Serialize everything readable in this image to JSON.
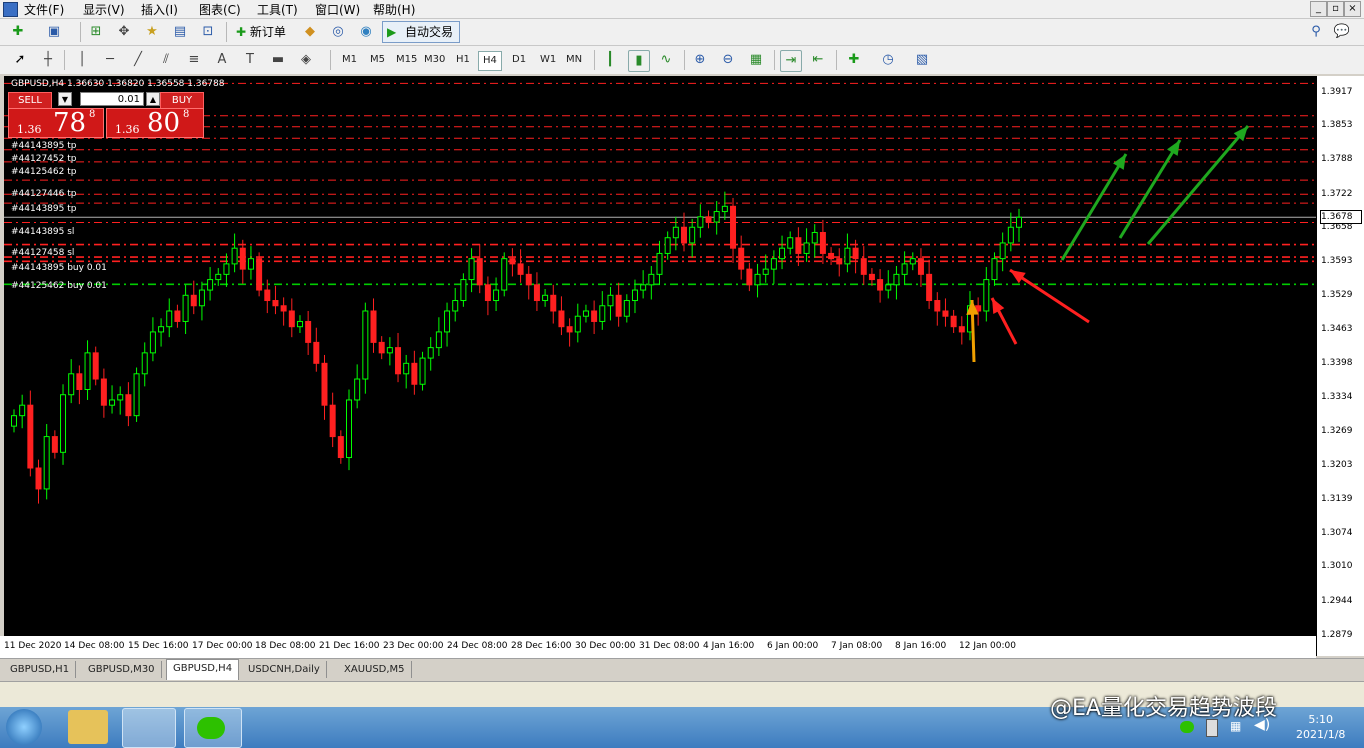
{
  "menu": {
    "items": [
      "文件(F)",
      "显示(V)",
      "插入(I)",
      "图表(C)",
      "工具(T)",
      "窗口(W)",
      "帮助(H)"
    ]
  },
  "toolbar": {
    "new_order_label": "新订单",
    "autotrade_label": "自动交易",
    "timeframes": [
      "M1",
      "M5",
      "M15",
      "M30",
      "H1",
      "H4",
      "D1",
      "W1",
      "MN"
    ],
    "active_timeframe": "H4"
  },
  "chart": {
    "header": "GBPUSD,H4  1.36630 1.36820 1.36558 1.36788",
    "current_price": "1.3678",
    "colors": {
      "bull": "#00ff00",
      "bear": "#ff2020",
      "background": "#000000",
      "tp_sl_line": "#ff2020",
      "buy_line": "#00cc00"
    },
    "order_labels": [
      "#44143895 tp",
      "#44127452 tp",
      "#44125462 tp",
      "#44127446 tp",
      "#44143895 tp",
      "#44143895 sl",
      "#44127458 sl",
      "#44143895 buy 0.01",
      "#44125462 buy 0.01"
    ]
  },
  "trade_panel": {
    "sell_label": "SELL",
    "buy_label": "BUY",
    "lot": "0.01",
    "sell_small": "1.36",
    "sell_big": "78",
    "sell_sup": "8",
    "buy_small": "1.36",
    "buy_big": "80",
    "buy_sup": "8"
  },
  "chart_data": {
    "type": "candlestick",
    "symbol": "GBPUSD",
    "timeframe": "H4",
    "ylim": [
      1.2879,
      1.3949
    ],
    "y_ticks": [
      "1.3917",
      "1.3853",
      "1.3788",
      "1.3722",
      "1.3658",
      "1.3593",
      "1.3529",
      "1.3463",
      "1.3398",
      "1.3334",
      "1.3269",
      "1.3203",
      "1.3139",
      "1.3074",
      "1.3010",
      "1.2944",
      "1.2879"
    ],
    "x_ticks": [
      "11 Dec 2020",
      "14 Dec 08:00",
      "15 Dec 16:00",
      "17 Dec 00:00",
      "18 Dec 08:00",
      "21 Dec 16:00",
      "23 Dec 00:00",
      "24 Dec 08:00",
      "28 Dec 16:00",
      "30 Dec 00:00",
      "31 Dec 08:00",
      "4 Jan 16:00",
      "6 Jan 00:00",
      "7 Jan 08:00",
      "8 Jan 16:00",
      "12 Jan 00:00"
    ],
    "red_levels": [
      1.3935,
      1.3873,
      1.3852,
      1.383,
      1.3808,
      1.3785,
      1.375,
      1.3723,
      1.3706,
      1.3669,
      1.3627,
      1.3603,
      1.3595
    ],
    "green_levels": [
      1.3551
    ],
    "closes": [
      1.33,
      1.332,
      1.32,
      1.316,
      1.326,
      1.323,
      1.334,
      1.338,
      1.335,
      1.342,
      1.337,
      1.332,
      1.333,
      1.334,
      1.33,
      1.338,
      1.342,
      1.346,
      1.347,
      1.35,
      1.348,
      1.353,
      1.351,
      1.354,
      1.356,
      1.357,
      1.359,
      1.362,
      1.358,
      1.36,
      1.354,
      1.352,
      1.351,
      1.35,
      1.347,
      1.348,
      1.344,
      1.34,
      1.332,
      1.326,
      1.322,
      1.333,
      1.337,
      1.35,
      1.344,
      1.342,
      1.343,
      1.338,
      1.34,
      1.336,
      1.341,
      1.343,
      1.346,
      1.35,
      1.352,
      1.356,
      1.36,
      1.355,
      1.352,
      1.354,
      1.36,
      1.359,
      1.357,
      1.355,
      1.352,
      1.353,
      1.35,
      1.347,
      1.346,
      1.349,
      1.35,
      1.348,
      1.351,
      1.353,
      1.349,
      1.352,
      1.354,
      1.355,
      1.357,
      1.361,
      1.364,
      1.366,
      1.363,
      1.366,
      1.368,
      1.367,
      1.369,
      1.37,
      1.362,
      1.358,
      1.355,
      1.357,
      1.358,
      1.36,
      1.362,
      1.364,
      1.361,
      1.363,
      1.365,
      1.361,
      1.36,
      1.359,
      1.362,
      1.36,
      1.357,
      1.356,
      1.354,
      1.355,
      1.357,
      1.359,
      1.36,
      1.357,
      1.352,
      1.35,
      1.349,
      1.347,
      1.346,
      1.351,
      1.35,
      1.356,
      1.36,
      1.363,
      1.366,
      1.3679
    ],
    "annotations": [
      "green trend arrows up-right",
      "red arrows pointing to entry",
      "yellow arrow up at breakout"
    ]
  },
  "tabs": [
    "GBPUSD,H1",
    "GBPUSD,M30",
    "GBPUSD,H4",
    "USDCNH,Daily",
    "XAUUSD,M5"
  ],
  "active_tab": "GBPUSD,H4",
  "watermark": "@EA量化交易趋势波段",
  "clock": {
    "time": "5:10",
    "date": "2021/1/8"
  }
}
